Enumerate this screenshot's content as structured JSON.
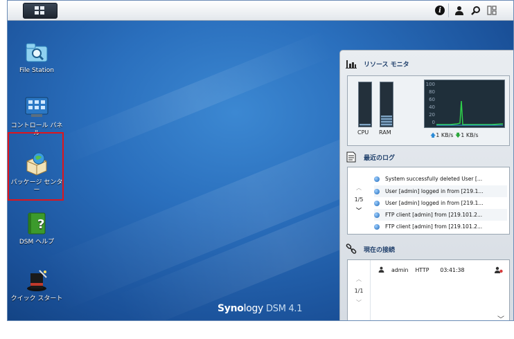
{
  "taskbar": {
    "icons": [
      "main-menu-icon",
      "info-icon",
      "user-icon",
      "search-icon",
      "widgets-icon"
    ]
  },
  "desktop": {
    "icons": [
      {
        "label": "File Station",
        "icon": "folder-search-icon"
      },
      {
        "label": "コントロール パネル",
        "icon": "control-panel-icon"
      },
      {
        "label": "パッケージ センター",
        "icon": "package-center-icon"
      },
      {
        "label": "DSM ヘルプ",
        "icon": "help-book-icon"
      },
      {
        "label": "クイック スタート",
        "icon": "magic-hat-icon"
      }
    ],
    "selected_index": 2
  },
  "brand": {
    "name_bold": "Syno",
    "name_rest": "logy",
    "product": "DSM 4.1"
  },
  "widgets": {
    "resource_monitor": {
      "title": "リソース モニタ",
      "cpu_label": "CPU",
      "ram_label": "RAM",
      "cpu_level": 0.05,
      "ram_level": 0.25,
      "y_ticks": [
        "100",
        "80",
        "60",
        "40",
        "20",
        "0"
      ],
      "upload": "1 KB/s",
      "download": "1 KB/s",
      "colors": {
        "cpu_line": "#2fd04a",
        "ram_line": "#35a8e8"
      }
    },
    "recent_logs": {
      "title": "最近のログ",
      "page": "1/5",
      "rows": [
        "System successfully deleted User [...",
        "User [admin] logged in from [219.1...",
        "User [admin] logged in from [219.1...",
        "FTP client [admin] from [219.101.2...",
        "FTP client [admin] from [219.101.2..."
      ]
    },
    "connections": {
      "title": "現在の接続",
      "page": "1/1",
      "rows": [
        {
          "user": "admin",
          "type": "HTTP",
          "time": "03:41:38"
        }
      ]
    }
  }
}
